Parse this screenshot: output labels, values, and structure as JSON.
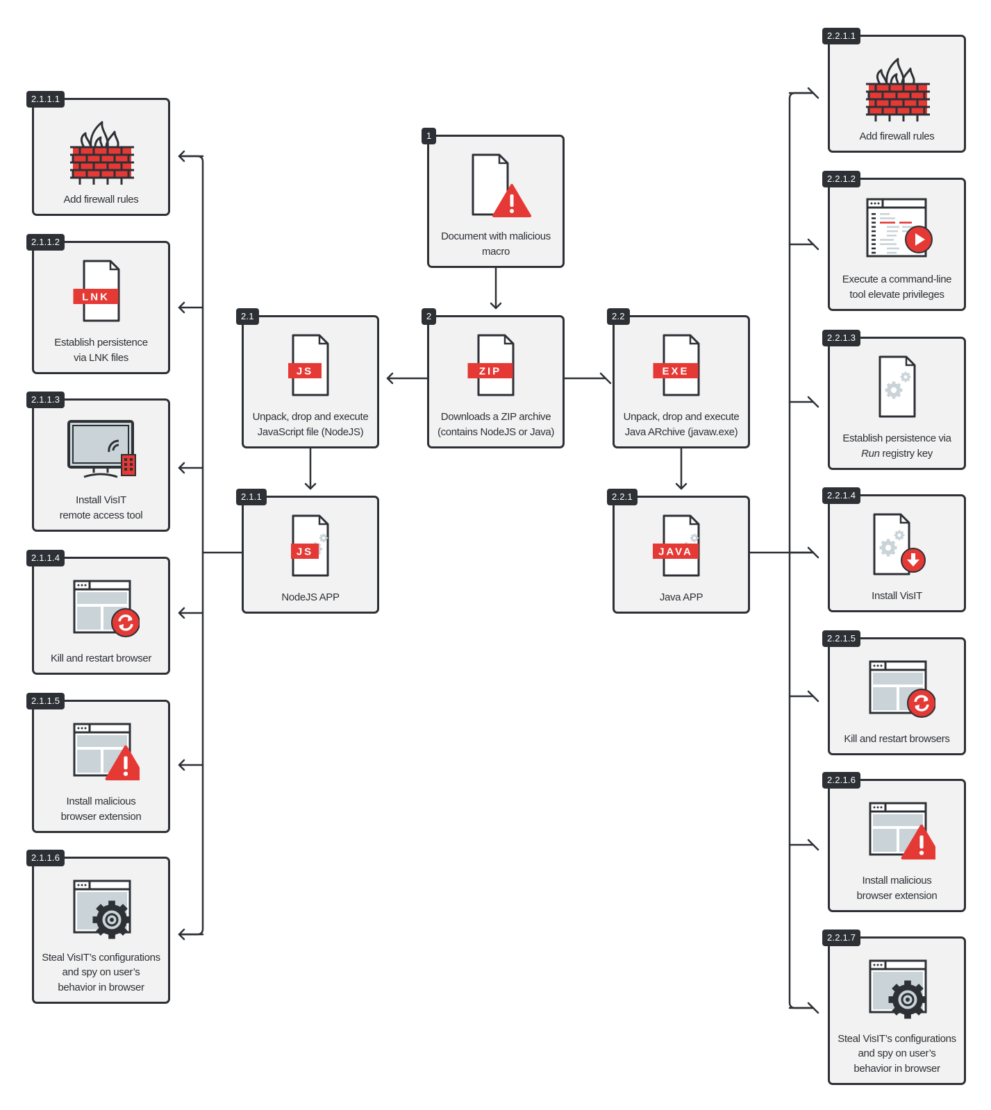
{
  "colors": {
    "accent": "#e53935",
    "ink": "#2d3035",
    "box": "#f2f2f2",
    "pane": "#c9d3d8"
  },
  "nodes": [
    {
      "id": "1",
      "icon": "doc-warning-icon",
      "label": [
        "Document with malicious",
        "macro"
      ]
    },
    {
      "id": "2",
      "icon": "doc-badge-icon",
      "badge": "ZIP",
      "label": [
        "Downloads a ZIP archive",
        "(contains NodeJS or Java)"
      ]
    },
    {
      "id": "2.1",
      "icon": "doc-badge-icon",
      "badge": "JS",
      "label": [
        "Unpack, drop and execute",
        "JavaScript file (NodeJS)"
      ]
    },
    {
      "id": "2.2",
      "icon": "doc-badge-icon",
      "badge": "EXE",
      "label": [
        "Unpack, drop and execute",
        "Java ARchive (javaw.exe)"
      ]
    },
    {
      "id": "2.1.1",
      "icon": "doc-gear-badge-icon",
      "badge": "JS",
      "label": [
        "NodeJS APP"
      ]
    },
    {
      "id": "2.2.1",
      "icon": "doc-gear-badge-icon",
      "badge": "JAVA",
      "label": [
        "Java APP"
      ]
    },
    {
      "id": "2.1.1.1",
      "icon": "firewall-icon",
      "label": [
        "Add firewall rules"
      ]
    },
    {
      "id": "2.1.1.2",
      "icon": "doc-badge-icon",
      "badge": "LNK",
      "label": [
        "Establish persistence",
        "via LNK files"
      ]
    },
    {
      "id": "2.1.1.3",
      "icon": "monitor-remote-icon",
      "label": [
        "Install VisIT",
        "remote access tool"
      ]
    },
    {
      "id": "2.1.1.4",
      "icon": "browser-refresh-icon",
      "label": [
        "Kill and restart browser"
      ]
    },
    {
      "id": "2.1.1.5",
      "icon": "browser-warning-icon",
      "label": [
        "Install malicious",
        "browser extension"
      ]
    },
    {
      "id": "2.1.1.6",
      "icon": "browser-gear-icon",
      "label": [
        "Steal VisIT’s configurations",
        "and spy on user’s",
        "behavior in browser"
      ]
    },
    {
      "id": "2.2.1.1",
      "icon": "firewall-icon",
      "label": [
        "Add firewall rules"
      ]
    },
    {
      "id": "2.2.1.2",
      "icon": "terminal-play-icon",
      "label": [
        "Execute a command-line",
        "tool elevate privileges"
      ]
    },
    {
      "id": "2.2.1.3",
      "icon": "doc-gear-icon",
      "label": [
        "Establish persistence via",
        "Run registry key"
      ],
      "italic": "Run"
    },
    {
      "id": "2.2.1.4",
      "icon": "doc-gear-download-icon",
      "label": [
        "Install VisIT"
      ]
    },
    {
      "id": "2.2.1.5",
      "icon": "browser-refresh-icon",
      "label": [
        "Kill and restart browsers"
      ]
    },
    {
      "id": "2.2.1.6",
      "icon": "browser-warning-icon",
      "label": [
        "Install malicious",
        "browser extension"
      ]
    },
    {
      "id": "2.2.1.7",
      "icon": "browser-gear-icon",
      "label": [
        "Steal VisIT’s configurations",
        "and spy on user’s",
        "behavior in browser"
      ]
    }
  ],
  "edges": [
    [
      "1",
      "2"
    ],
    [
      "2",
      "2.1"
    ],
    [
      "2",
      "2.2"
    ],
    [
      "2.1",
      "2.1.1"
    ],
    [
      "2.2",
      "2.2.1"
    ],
    [
      "2.1.1",
      "2.1.1.1"
    ],
    [
      "2.1.1",
      "2.1.1.2"
    ],
    [
      "2.1.1",
      "2.1.1.3"
    ],
    [
      "2.1.1",
      "2.1.1.4"
    ],
    [
      "2.1.1",
      "2.1.1.5"
    ],
    [
      "2.1.1",
      "2.1.1.6"
    ],
    [
      "2.2.1",
      "2.2.1.1"
    ],
    [
      "2.2.1",
      "2.2.1.2"
    ],
    [
      "2.2.1",
      "2.2.1.3"
    ],
    [
      "2.2.1",
      "2.2.1.4"
    ],
    [
      "2.2.1",
      "2.2.1.5"
    ],
    [
      "2.2.1",
      "2.2.1.6"
    ],
    [
      "2.2.1",
      "2.2.1.7"
    ]
  ]
}
